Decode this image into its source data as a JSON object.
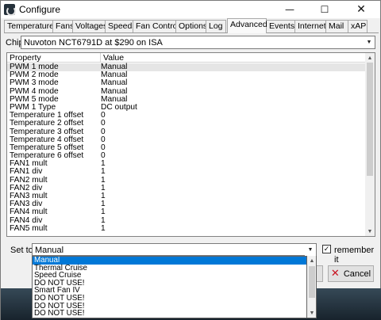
{
  "window": {
    "title": "Configure",
    "min_glyph": "—",
    "max_glyph": "☐",
    "close_glyph": "✕"
  },
  "tabs": [
    {
      "label": "Temperatures"
    },
    {
      "label": "Fans"
    },
    {
      "label": "Voltages"
    },
    {
      "label": "Speeds"
    },
    {
      "label": "Fan Control"
    },
    {
      "label": "Options"
    },
    {
      "label": "Log"
    },
    {
      "label": "Advanced",
      "active": true
    },
    {
      "label": "Events"
    },
    {
      "label": "Internet"
    },
    {
      "label": "Mail"
    },
    {
      "label": "xAP"
    }
  ],
  "chip": {
    "label": "Chip",
    "value": "Nuvoton NCT6791D at $290 on ISA"
  },
  "list": {
    "columns": [
      "Property",
      "Value"
    ],
    "rows": [
      {
        "property": "PWM 1 mode",
        "value": "Manual",
        "selected": true
      },
      {
        "property": "PWM 2 mode",
        "value": "Manual"
      },
      {
        "property": "PWM 3 mode",
        "value": "Manual"
      },
      {
        "property": "PWM 4 mode",
        "value": "Manual"
      },
      {
        "property": "PWM 5 mode",
        "value": "Manual"
      },
      {
        "property": "PWM 1 Type",
        "value": "DC output"
      },
      {
        "property": "Temperature 1 offset",
        "value": "0"
      },
      {
        "property": "Temperature 2 offset",
        "value": "0"
      },
      {
        "property": "Temperature 3 offset",
        "value": "0"
      },
      {
        "property": "Temperature 4 offset",
        "value": "0"
      },
      {
        "property": "Temperature 5 offset",
        "value": "0"
      },
      {
        "property": "Temperature 6 offset",
        "value": "0"
      },
      {
        "property": "FAN1 mult",
        "value": "1"
      },
      {
        "property": "FAN1 div",
        "value": "1"
      },
      {
        "property": "FAN2 mult",
        "value": "1"
      },
      {
        "property": "FAN2 div",
        "value": "1"
      },
      {
        "property": "FAN3 mult",
        "value": "1"
      },
      {
        "property": "FAN3 div",
        "value": "1"
      },
      {
        "property": "FAN4 mult",
        "value": "1"
      },
      {
        "property": "FAN4 div",
        "value": "1"
      },
      {
        "property": "FAN5 mult",
        "value": "1"
      }
    ]
  },
  "set_to": {
    "label": "Set to",
    "value": "Manual",
    "options": [
      {
        "label": "Manual",
        "highlighted": true
      },
      {
        "label": "Thermal Cruise"
      },
      {
        "label": "Speed Cruise"
      },
      {
        "label": "DO NOT USE!"
      },
      {
        "label": "Smart Fan IV"
      },
      {
        "label": "DO NOT USE!"
      },
      {
        "label": "DO NOT USE!"
      },
      {
        "label": "DO NOT USE!"
      }
    ]
  },
  "remember": {
    "label": "remember it",
    "checked": true,
    "check_glyph": "✓"
  },
  "buttons": {
    "cancel_label": "Cancel"
  },
  "icons": {
    "scroll_up": "▲",
    "scroll_down": "▼",
    "dropdown": "▼",
    "cancel_icon": "✕"
  },
  "colors": {
    "selection_blue": "#0078d7",
    "cancel_red": "#c8101e"
  }
}
